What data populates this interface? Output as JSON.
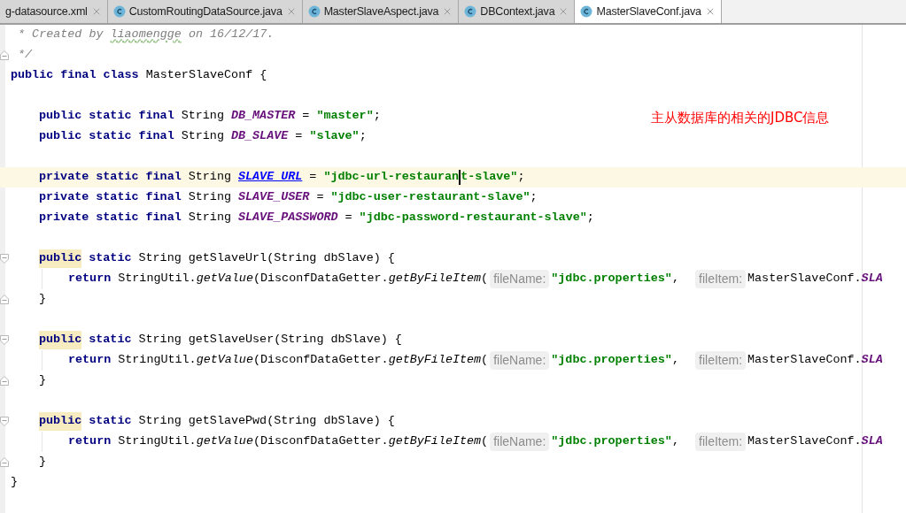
{
  "tabs": [
    {
      "label": "g-datasource.xml",
      "icon": false,
      "selected": false
    },
    {
      "label": "CustomRoutingDataSource.java",
      "icon": true,
      "selected": false
    },
    {
      "label": "MasterSlaveAspect.java",
      "icon": true,
      "selected": false
    },
    {
      "label": "DBContext.java",
      "icon": true,
      "selected": false
    },
    {
      "label": "MasterSlaveConf.java",
      "icon": true,
      "selected": true
    }
  ],
  "annotation": "主从数据库的相关的JDBC信息",
  "lines": [
    {
      "kind": "line",
      "current": false,
      "tokens": [
        {
          "kind": "comment",
          "text": " * Created by "
        },
        {
          "kind": "comment-typo",
          "text": "liaomengge"
        },
        {
          "kind": "comment",
          "text": " on 16/12/17."
        }
      ]
    },
    {
      "kind": "block-end",
      "current": false,
      "tokens": [
        {
          "kind": "comment",
          "text": " */"
        }
      ]
    },
    {
      "kind": "line",
      "current": false,
      "tokens": [
        {
          "kind": "keyword",
          "text": "public final class "
        },
        {
          "kind": "plain",
          "text": "MasterSlaveConf {"
        }
      ],
      "children": [
        {
          "kind": "line",
          "current": false
        },
        {
          "kind": "line",
          "current": false,
          "tokens": [
            {
              "kind": "keyword",
              "text": "public static final "
            },
            {
              "kind": "plain",
              "text": "String "
            },
            {
              "kind": "constant",
              "text": "DB_MASTER"
            },
            {
              "kind": "plain",
              "text": " = "
            },
            {
              "kind": "string",
              "text": "\"master\""
            },
            {
              "kind": "plain",
              "text": ";"
            }
          ]
        },
        {
          "kind": "line",
          "current": false,
          "tokens": [
            {
              "kind": "keyword",
              "text": "public static final "
            },
            {
              "kind": "plain",
              "text": "String "
            },
            {
              "kind": "constant",
              "text": "DB_SLAVE"
            },
            {
              "kind": "plain",
              "text": " = "
            },
            {
              "kind": "string",
              "text": "\"slave\""
            },
            {
              "kind": "plain",
              "text": ";"
            }
          ]
        },
        {
          "kind": "line",
          "current": false
        },
        {
          "kind": "line",
          "current": true,
          "tokens": [
            {
              "kind": "keyword",
              "text": "private static final "
            },
            {
              "kind": "plain",
              "text": "String "
            },
            {
              "kind": "constant-link",
              "text": "SLAVE_URL"
            },
            {
              "kind": "plain",
              "text": " = "
            },
            {
              "kind": "string",
              "text": "\"jdbc-url-restauran"
            },
            {
              "kind": "caret"
            },
            {
              "kind": "string",
              "text": "t-slave\""
            },
            {
              "kind": "plain",
              "text": ";"
            }
          ]
        },
        {
          "kind": "line",
          "current": false,
          "tokens": [
            {
              "kind": "keyword",
              "text": "private static final "
            },
            {
              "kind": "plain",
              "text": "String "
            },
            {
              "kind": "constant",
              "text": "SLAVE_USER"
            },
            {
              "kind": "plain",
              "text": " = "
            },
            {
              "kind": "string",
              "text": "\"jdbc-user-restaurant-slave\""
            },
            {
              "kind": "plain",
              "text": ";"
            }
          ]
        },
        {
          "kind": "line",
          "current": false,
          "tokens": [
            {
              "kind": "keyword",
              "text": "private static final "
            },
            {
              "kind": "plain",
              "text": "String "
            },
            {
              "kind": "constant",
              "text": "SLAVE_PASSWORD"
            },
            {
              "kind": "plain",
              "text": " = "
            },
            {
              "kind": "string",
              "text": "\"jdbc-password-restaurant-slave\""
            },
            {
              "kind": "plain",
              "text": ";"
            }
          ]
        },
        {
          "kind": "line",
          "current": false
        },
        {
          "kind": "block-start",
          "current": false,
          "tokens": [
            {
              "kind": "keyword-marked",
              "text": "public"
            },
            {
              "kind": "keyword",
              "text": " static "
            },
            {
              "kind": "plain",
              "text": "String getSlaveUrl(String dbSlave) {"
            }
          ],
          "children": [
            {
              "kind": "line",
              "current": false,
              "tokens": [
                {
                  "kind": "keyword",
                  "text": "return "
                },
                {
                  "kind": "plain",
                  "text": "StringUtil."
                },
                {
                  "kind": "static-call",
                  "text": "getValue"
                },
                {
                  "kind": "plain",
                  "text": "(DisconfDataGetter."
                },
                {
                  "kind": "static-call",
                  "text": "getByFileItem"
                },
                {
                  "kind": "plain",
                  "text": "("
                },
                {
                  "kind": "hint",
                  "text": "fileName:"
                },
                {
                  "kind": "string",
                  "text": "\"jdbc.properties\""
                },
                {
                  "kind": "plain",
                  "text": ",  "
                },
                {
                  "kind": "hint",
                  "text": "fileItem:"
                },
                {
                  "kind": "plain",
                  "text": "MasterSlaveConf."
                },
                {
                  "kind": "constant",
                  "text": "SLA"
                }
              ]
            }
          ]
        },
        {
          "kind": "block-end",
          "current": false,
          "tokens": [
            {
              "kind": "plain",
              "text": "}"
            }
          ]
        },
        {
          "kind": "line",
          "current": false
        },
        {
          "kind": "block-start",
          "current": false,
          "tokens": [
            {
              "kind": "keyword-marked",
              "text": "public"
            },
            {
              "kind": "keyword",
              "text": " static "
            },
            {
              "kind": "plain",
              "text": "String getSlaveUser(String dbSlave) {"
            }
          ],
          "children": [
            {
              "kind": "line",
              "current": false,
              "tokens": [
                {
                  "kind": "keyword",
                  "text": "return "
                },
                {
                  "kind": "plain",
                  "text": "StringUtil."
                },
                {
                  "kind": "static-call",
                  "text": "getValue"
                },
                {
                  "kind": "plain",
                  "text": "(DisconfDataGetter."
                },
                {
                  "kind": "static-call",
                  "text": "getByFileItem"
                },
                {
                  "kind": "plain",
                  "text": "("
                },
                {
                  "kind": "hint",
                  "text": "fileName:"
                },
                {
                  "kind": "string",
                  "text": "\"jdbc.properties\""
                },
                {
                  "kind": "plain",
                  "text": ",  "
                },
                {
                  "kind": "hint",
                  "text": "fileItem:"
                },
                {
                  "kind": "plain",
                  "text": "MasterSlaveConf."
                },
                {
                  "kind": "constant",
                  "text": "SLA"
                }
              ]
            }
          ]
        },
        {
          "kind": "block-end",
          "current": false,
          "tokens": [
            {
              "kind": "plain",
              "text": "}"
            }
          ]
        },
        {
          "kind": "line",
          "current": false
        },
        {
          "kind": "block-start",
          "current": false,
          "tokens": [
            {
              "kind": "keyword-marked",
              "text": "public"
            },
            {
              "kind": "keyword",
              "text": " static "
            },
            {
              "kind": "plain",
              "text": "String getSlavePwd(String dbSlave) {"
            }
          ],
          "children": [
            {
              "kind": "line",
              "current": false,
              "tokens": [
                {
                  "kind": "keyword",
                  "text": "return "
                },
                {
                  "kind": "plain",
                  "text": "StringUtil."
                },
                {
                  "kind": "static-call",
                  "text": "getValue"
                },
                {
                  "kind": "plain",
                  "text": "(DisconfDataGetter."
                },
                {
                  "kind": "static-call",
                  "text": "getByFileItem"
                },
                {
                  "kind": "plain",
                  "text": "("
                },
                {
                  "kind": "hint",
                  "text": "fileName:"
                },
                {
                  "kind": "string",
                  "text": "\"jdbc.properties\""
                },
                {
                  "kind": "plain",
                  "text": ",  "
                },
                {
                  "kind": "hint",
                  "text": "fileItem:"
                },
                {
                  "kind": "plain",
                  "text": "MasterSlaveConf."
                },
                {
                  "kind": "constant",
                  "text": "SLA"
                }
              ]
            }
          ]
        },
        {
          "kind": "block-end",
          "current": false,
          "tokens": [
            {
              "kind": "plain",
              "text": "}"
            }
          ]
        }
      ]
    },
    {
      "kind": "line",
      "current": false,
      "tokens": [
        {
          "kind": "plain",
          "text": "}"
        }
      ]
    }
  ]
}
